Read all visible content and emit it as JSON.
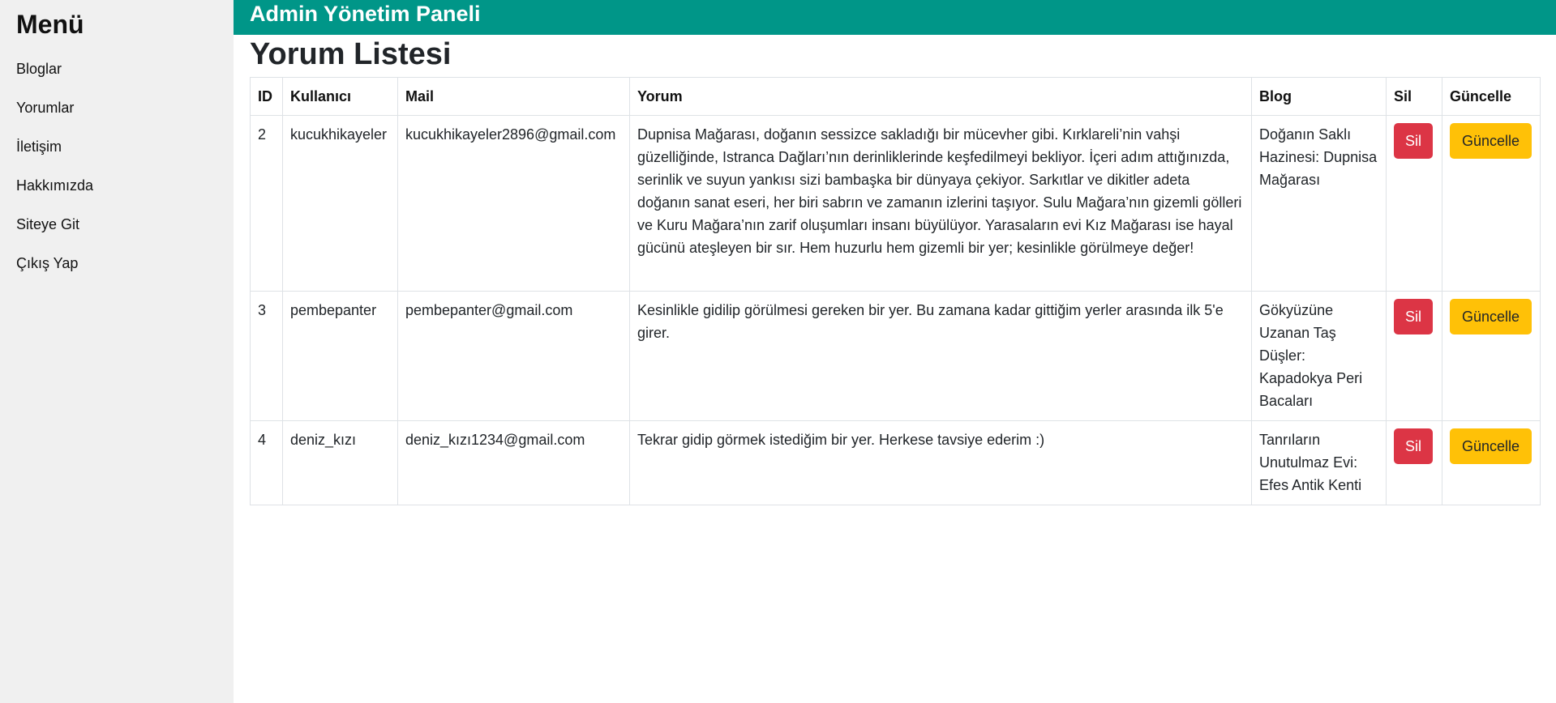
{
  "sidebar": {
    "title": "Menü",
    "items": [
      {
        "label": "Bloglar"
      },
      {
        "label": "Yorumlar"
      },
      {
        "label": "İletişim"
      },
      {
        "label": "Hakkımızda"
      },
      {
        "label": "Siteye Git"
      },
      {
        "label": "Çıkış Yap"
      }
    ]
  },
  "header": {
    "title": "Admin Yönetim Paneli"
  },
  "main": {
    "title": "Yorum Listesi",
    "columns": [
      "ID",
      "Kullanıcı",
      "Mail",
      "Yorum",
      "Blog",
      "Sil",
      "Güncelle"
    ],
    "rows": [
      {
        "id": "2",
        "user": "kucukhikayeler",
        "mail": "kucukhikayeler2896@gmail.com",
        "comment": "Dupnisa Mağarası, doğanın sessizce sakladığı bir mücevher gibi. Kırklareli’nin vahşi güzelliğinde, Istranca Dağları’nın derinliklerinde keşfedilmeyi bekliyor. İçeri adım attığınızda, serinlik ve suyun yankısı sizi bambaşka bir dünyaya çekiyor. Sarkıtlar ve dikitler adeta doğanın sanat eseri, her biri sabrın ve zamanın izlerini taşıyor. Sulu Mağara’nın gizemli gölleri ve Kuru Mağara’nın zarif oluşumları insanı büyülüyor. Yarasaların evi Kız Mağarası ise hayal gücünü ateşleyen bir sır. Hem huzurlu hem gizemli bir yer; kesinlikle görülmeye değer!",
        "blog": "Doğanın Saklı Hazinesi: Dupnisa Mağarası",
        "delete_label": "Sil",
        "update_label": "Güncelle"
      },
      {
        "id": "3",
        "user": "pembepanter",
        "mail": "pembepanter@gmail.com",
        "comment": "Kesinlikle gidilip görülmesi gereken bir yer. Bu zamana kadar gittiğim yerler arasında ilk 5'e girer.",
        "blog": "Gökyüzüne Uzanan Taş Düşler: Kapadokya Peri Bacaları",
        "delete_label": "Sil",
        "update_label": "Güncelle"
      },
      {
        "id": "4",
        "user": "deniz_kızı",
        "mail": "deniz_kızı1234@gmail.com",
        "comment": "Tekrar gidip görmek istediğim bir yer. Herkese tavsiye ederim :)",
        "blog": "Tanrıların Unutulmaz Evi: Efes Antik Kenti",
        "delete_label": "Sil",
        "update_label": "Güncelle"
      }
    ]
  },
  "colors": {
    "header_bg": "#009688",
    "sidebar_bg": "#f0f0f0",
    "delete_btn": "#dc3545",
    "update_btn": "#ffc107"
  }
}
